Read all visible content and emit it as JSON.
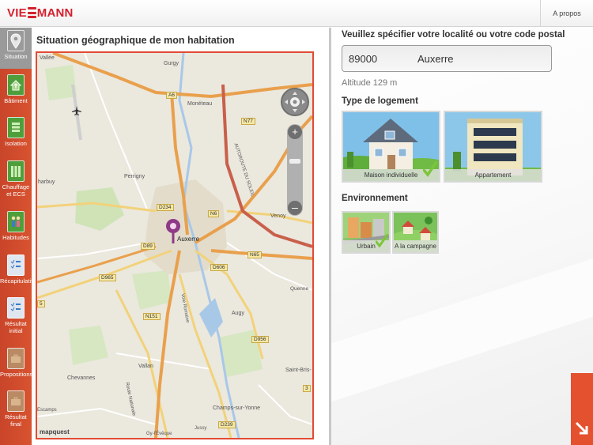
{
  "header": {
    "logo_text_left": "VIE",
    "logo_text_right": "MANN",
    "about_label": "A propos"
  },
  "sidebar": {
    "items": [
      {
        "label": "Situation",
        "icon": "location-pin-icon",
        "active": true
      },
      {
        "label": "Bâtiment",
        "icon": "house-arrow-icon"
      },
      {
        "label": "Isolation",
        "icon": "insulation-layers-icon"
      },
      {
        "label": "Chauffage et ECS",
        "icon": "radiator-icon"
      },
      {
        "label": "Habitudes",
        "icon": "people-icon"
      },
      {
        "label": "Récapitulatif",
        "icon": "checklist-icon"
      },
      {
        "label": "Résultat initial",
        "icon": "checklist-icon"
      },
      {
        "label": "Propositions",
        "icon": "briefcase-icon"
      },
      {
        "label": "Résultat final",
        "icon": "briefcase-icon"
      }
    ]
  },
  "map": {
    "title": "Situation géographique de mon habitation",
    "brand": "mapquest",
    "labels": {
      "vallee": "Vallée",
      "gurgy": "Gurgy",
      "moneteau": "Monéteau",
      "a6": "A6",
      "n77": "N77",
      "autoroute": "AUTOROUTE DU SOLEIL",
      "perrigny": "Perrigny",
      "charbuy": "harbuy",
      "d234": "D234",
      "n6": "N6",
      "venoy": "Venoy",
      "auxerre": "Auxerre",
      "d89": "D89",
      "n65": "N65",
      "d606": "D606",
      "d965": "D965",
      "quenne": "Quenne",
      "n151": "N151",
      "voie_romaine": "Voie Romaine",
      "augy": "Augy",
      "d956": "D956",
      "chevannes": "Chevannes",
      "vallan": "Vallan",
      "route_nationale": "Route Nationale",
      "saint_bris": "Saint-Bris-",
      "champs": "Champs-sur-Yonne",
      "escamps": "Escamps",
      "gy_leveque": "Gy-l'Évêque",
      "jussy": "Jussy",
      "d239": "D239",
      "d3": "3",
      "n5": "5"
    }
  },
  "location": {
    "prompt": "Veuillez spécifier votre localité ou votre code postal",
    "postal_code": "89000",
    "city": "Auxerre",
    "altitude": "Altitude 129  m"
  },
  "housing": {
    "title": "Type de logement",
    "options": [
      {
        "label": "Maison individuelle",
        "selected": true
      },
      {
        "label": "Appartement",
        "selected": false
      }
    ]
  },
  "environment": {
    "title": "Environnement",
    "options": [
      {
        "label": "Urbain",
        "selected": true
      },
      {
        "label": "A la campagne",
        "selected": false
      }
    ]
  },
  "colors": {
    "brand_red": "#d3202e",
    "sidebar_orange": "#d04b2c",
    "map_border": "#e24b35",
    "check_green": "#7cc53a"
  }
}
